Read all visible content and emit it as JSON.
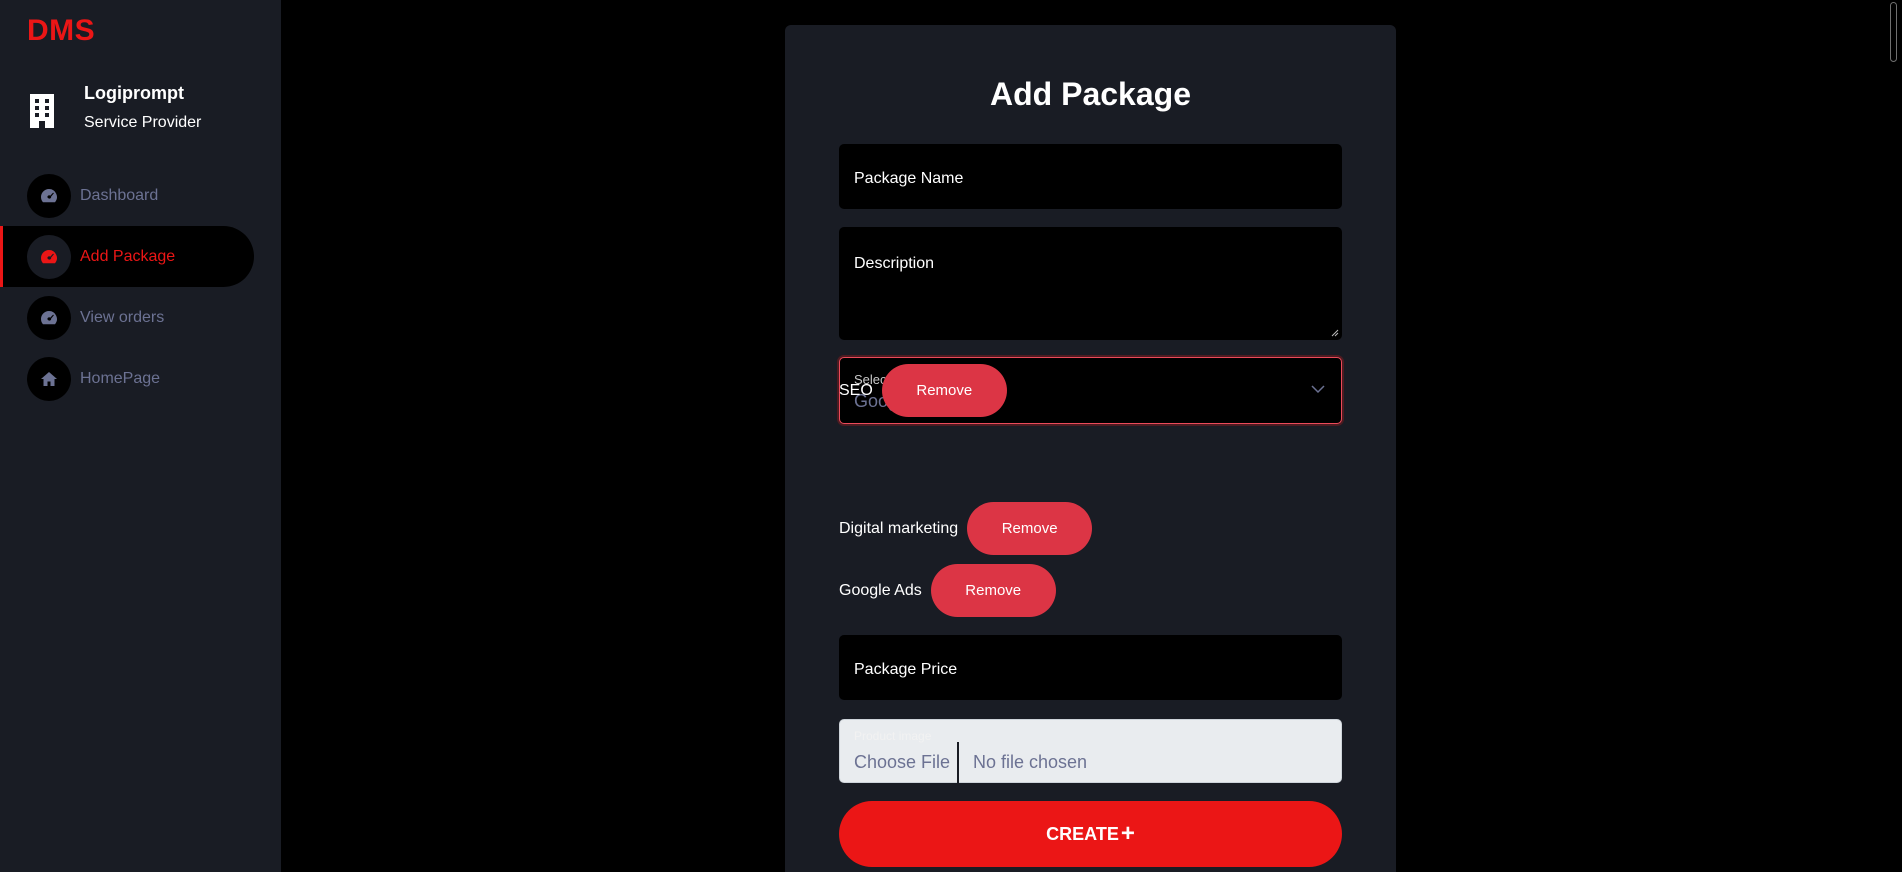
{
  "sidebar": {
    "logo": "DMS",
    "profile": {
      "name": "Logiprompt",
      "role": "Service Provider",
      "icon": "building-icon"
    },
    "items": [
      {
        "label": "Dashboard",
        "icon": "gauge-icon",
        "active": false
      },
      {
        "label": "Add Package",
        "icon": "gauge-icon",
        "active": true
      },
      {
        "label": "View orders",
        "icon": "gauge-icon",
        "active": false
      },
      {
        "label": "HomePage",
        "icon": "home-icon",
        "active": false
      }
    ]
  },
  "form": {
    "title": "Add Package",
    "package_name_placeholder": "Package Name",
    "description_placeholder": "Description",
    "select_label": "Select Services",
    "select_value": "Google Ads",
    "services": [
      {
        "name": "SEO",
        "remove_label": "Remove"
      },
      {
        "name": "Digital marketing",
        "remove_label": "Remove"
      },
      {
        "name": "Google Ads",
        "remove_label": "Remove"
      }
    ],
    "price_placeholder": "Package Price",
    "image_label": "Product image",
    "choose_file_label": "Choose File",
    "no_file_label": "No file chosen",
    "create_label": "CREATE",
    "create_icon": "plus-icon"
  },
  "colors": {
    "accent": "#eb1616",
    "panel": "#191c24",
    "muted": "#6c7293",
    "danger": "#dc3545"
  }
}
